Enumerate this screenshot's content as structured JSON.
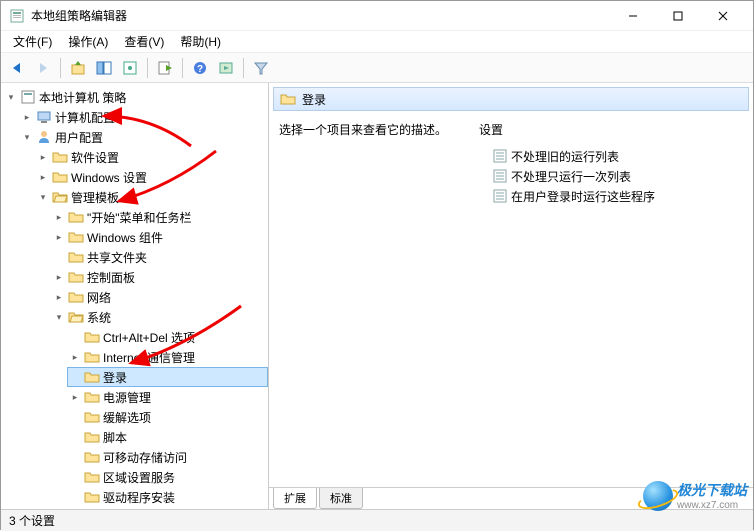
{
  "window": {
    "title": "本地组策略编辑器"
  },
  "menus": {
    "file": "文件(F)",
    "action": "操作(A)",
    "view": "查看(V)",
    "help": "帮助(H)"
  },
  "tree": {
    "root": "本地计算机 策略",
    "computer_config": "计算机配置",
    "user_config": "用户配置",
    "software_settings": "软件设置",
    "windows_settings": "Windows 设置",
    "admin_templates": "管理模板",
    "start_taskbar": "\"开始\"菜单和任务栏",
    "windows_components": "Windows 组件",
    "shared_folders": "共享文件夹",
    "control_panel": "控制面板",
    "network": "网络",
    "system": "系统",
    "ctrlaltdel": "Ctrl+Alt+Del 选项",
    "internet_comm": "Internet 通信管理",
    "logon": "登录",
    "power": "电源管理",
    "mitigation": "缓解选项",
    "scripts": "脚本",
    "removable": "可移动存储访问",
    "locale": "区域设置服务",
    "driver_install": "驱动程序安装"
  },
  "right": {
    "header": "登录",
    "desc": "选择一个项目来查看它的描述。",
    "settings_header": "设置",
    "settings": [
      "不处理旧的运行列表",
      "不处理只运行一次列表",
      "在用户登录时运行这些程序"
    ],
    "tab_extended": "扩展",
    "tab_standard": "标准"
  },
  "status": "3 个设置",
  "watermark": {
    "name": "极光下载站",
    "url": "www.xz7.com"
  }
}
